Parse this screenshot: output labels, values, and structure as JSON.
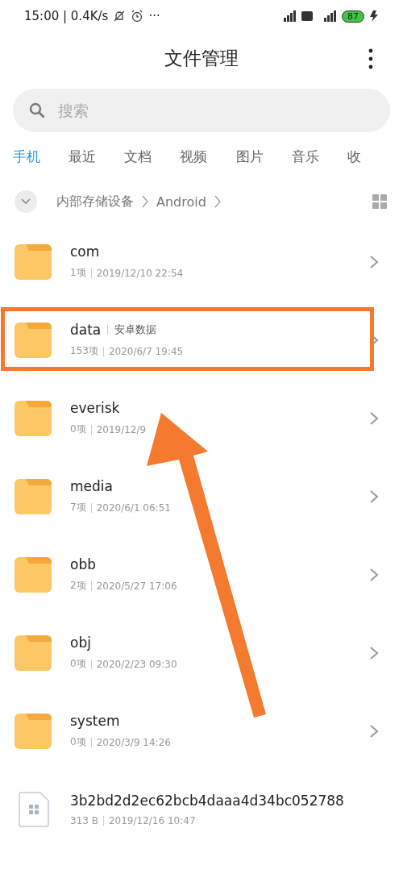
{
  "status_bar": {
    "time": "15:00 | 0.4K/s",
    "more": "···",
    "battery": "87"
  },
  "title_bar": {
    "title": "文件管理"
  },
  "search": {
    "placeholder": "搜索"
  },
  "tabs": [
    {
      "label": "手机",
      "selected": true
    },
    {
      "label": "最近",
      "selected": false
    },
    {
      "label": "文档",
      "selected": false
    },
    {
      "label": "视频",
      "selected": false
    },
    {
      "label": "图片",
      "selected": false
    },
    {
      "label": "音乐",
      "selected": false
    },
    {
      "label": "收",
      "selected": false
    }
  ],
  "breadcrumb": [
    "内部存储设备",
    "Android"
  ],
  "files": [
    {
      "kind": "folder",
      "name": "com",
      "count": "1项",
      "date": "2019/12/10 22:54",
      "highlighted": false
    },
    {
      "kind": "folder",
      "name": "data",
      "tag": "安卓数据",
      "count": "153项",
      "date": "2020/6/7 19:45",
      "highlighted": true
    },
    {
      "kind": "folder",
      "name": "everisk",
      "count": "0项",
      "date": "2019/12/9",
      "highlighted": false
    },
    {
      "kind": "folder",
      "name": "media",
      "count": "7项",
      "date": "2020/6/1 06:51",
      "highlighted": false
    },
    {
      "kind": "folder",
      "name": "obb",
      "count": "2项",
      "date": "2020/5/27 17:06",
      "highlighted": false
    },
    {
      "kind": "folder",
      "name": "obj",
      "count": "0项",
      "date": "2020/2/23 09:30",
      "highlighted": false
    },
    {
      "kind": "folder",
      "name": "system",
      "count": "0项",
      "date": "2020/3/9 14:26",
      "highlighted": false
    },
    {
      "kind": "file",
      "name": "3b2bd2d2ec62bcb4daaa4d34bc052788",
      "count": "313 B",
      "date": "2019/12/16 10:47",
      "highlighted": false
    }
  ],
  "annotations": [
    {
      "kind": "arrow"
    }
  ]
}
